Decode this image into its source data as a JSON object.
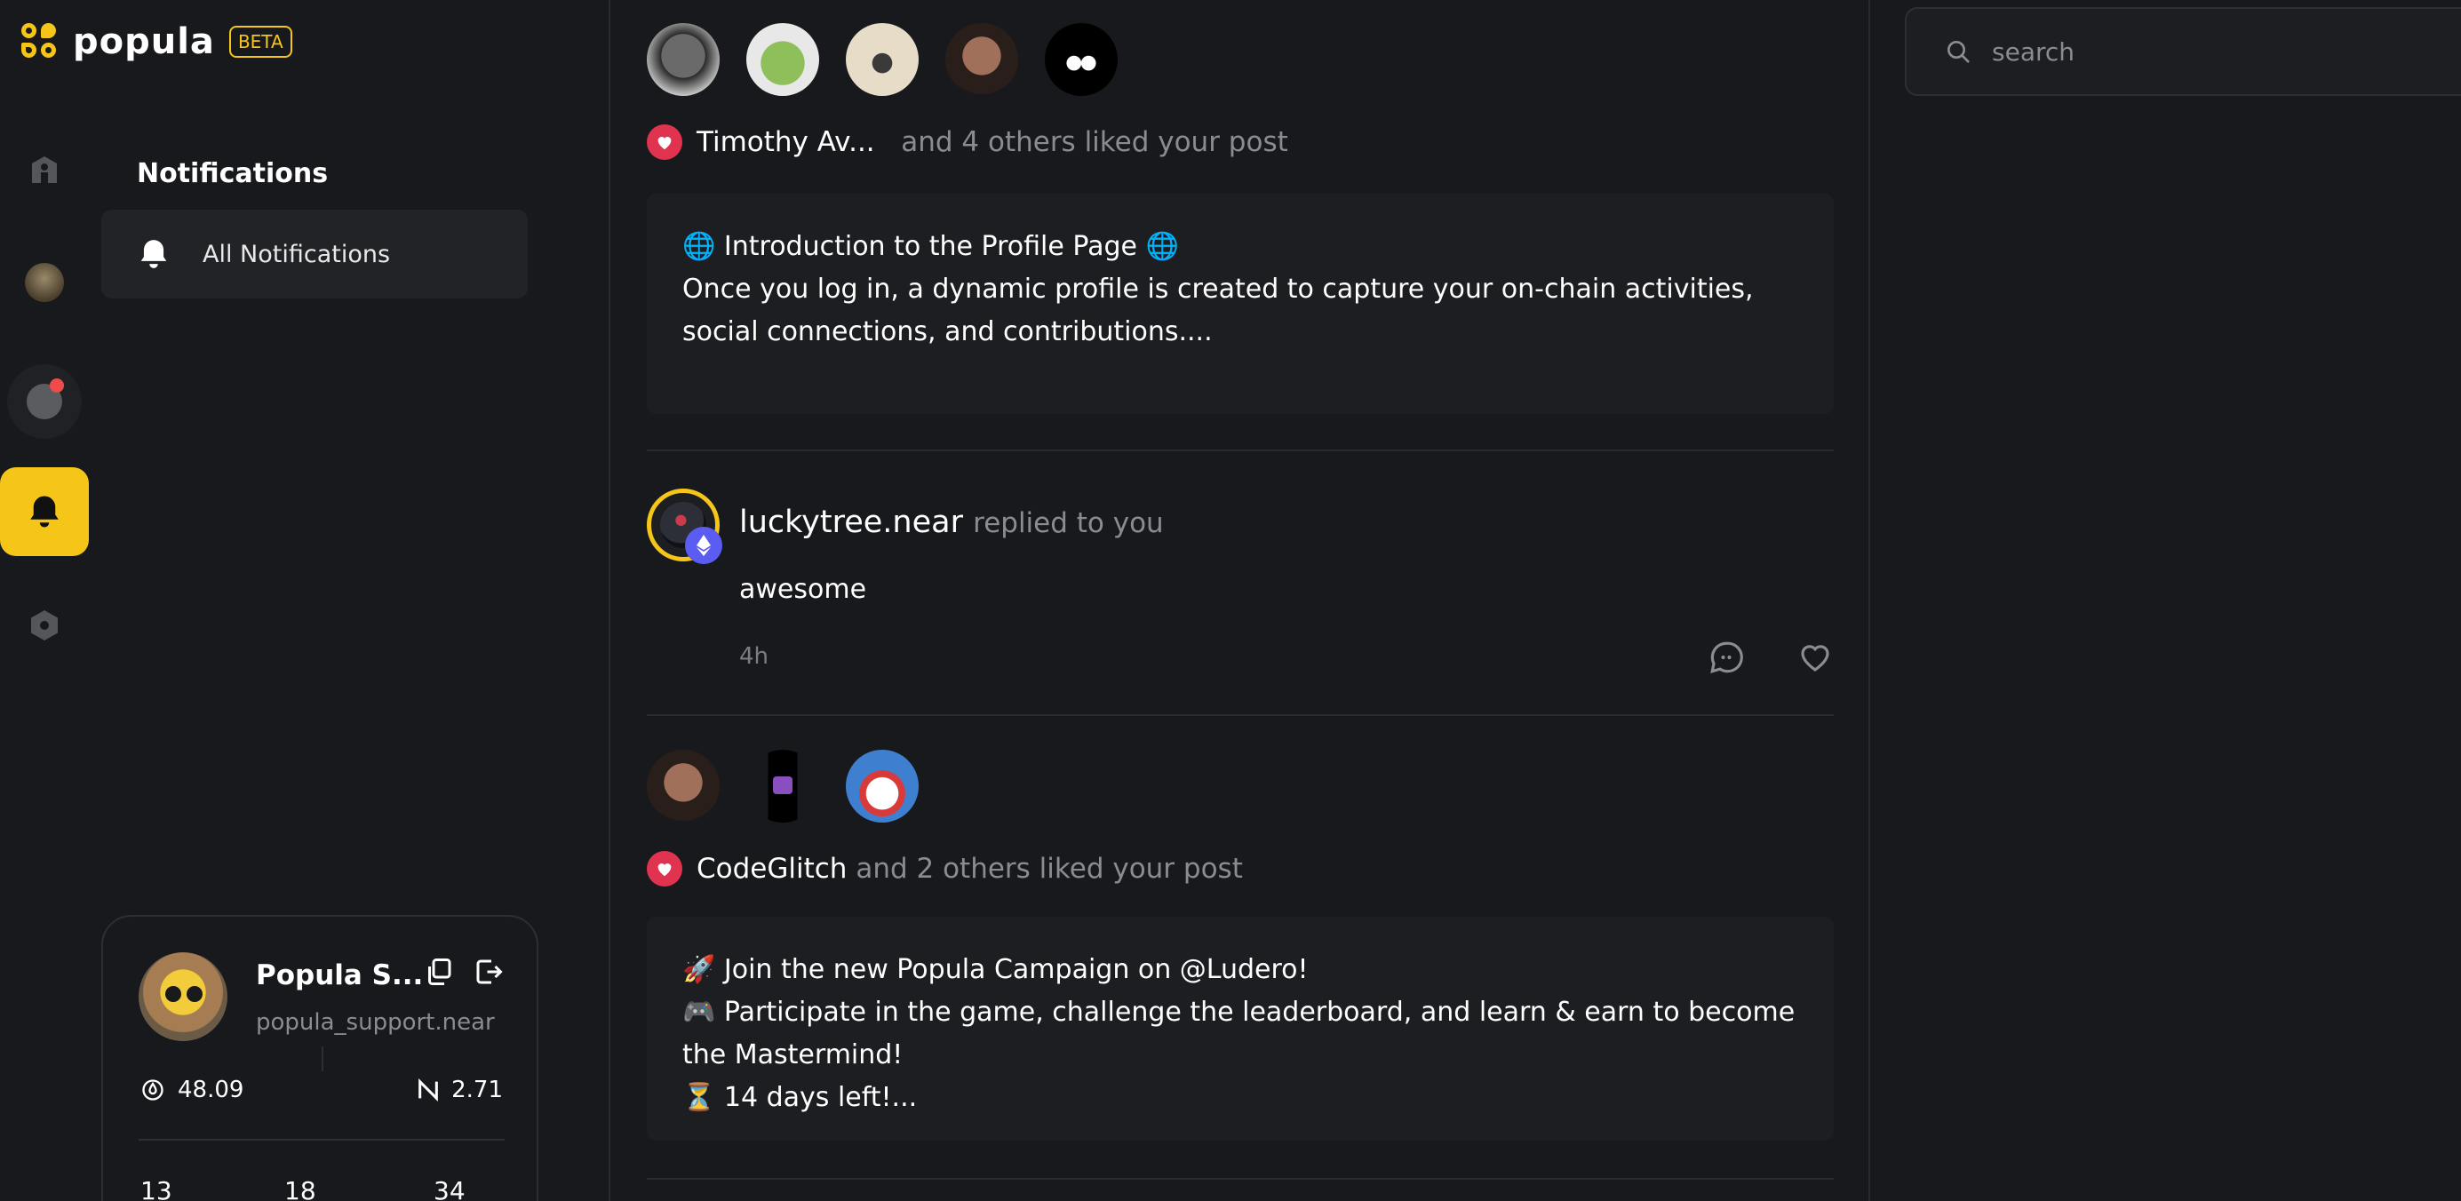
{
  "brand": {
    "name": "popula",
    "badge": "BETA"
  },
  "nav": {
    "home_icon": "home-icon",
    "profile_icon": "avatar",
    "explore_icon": "explore-icon",
    "notifications_icon": "bell-icon",
    "settings_icon": "settings-icon",
    "accent_color": "#f5c518"
  },
  "notifications_panel": {
    "title": "Notifications",
    "items": [
      {
        "label": "All Notifications",
        "icon": "bell-icon"
      }
    ]
  },
  "profile_card": {
    "name": "Popula S...",
    "handle": "popula_support.near",
    "balance_popula": "48.09",
    "balance_near": "2.71",
    "counts": [
      "13",
      "18",
      "34"
    ]
  },
  "feed": {
    "notifications": [
      {
        "type": "like",
        "actor": "Timothy Av...",
        "rest": "and 4 others liked your post",
        "post_lines": [
          "🌐 Introduction to the Profile Page 🌐",
          "",
          "Once you log in, a dynamic profile is created to capture your on-chain activities, social connections, and contributions...."
        ]
      },
      {
        "type": "reply",
        "actor": "luckytree.near",
        "action": "replied to you",
        "text": "awesome",
        "time": "4h"
      },
      {
        "type": "like",
        "actor": "CodeGlitch",
        "rest": "and 2 others liked your post",
        "post_lines": [
          "🚀 Join the new Popula Campaign on @Ludero!",
          "🎮 Participate in the game, challenge the leaderboard, and learn & earn to become the Mastermind!",
          "⏳ 14 days left!..."
        ]
      }
    ]
  },
  "search": {
    "placeholder": "search"
  }
}
